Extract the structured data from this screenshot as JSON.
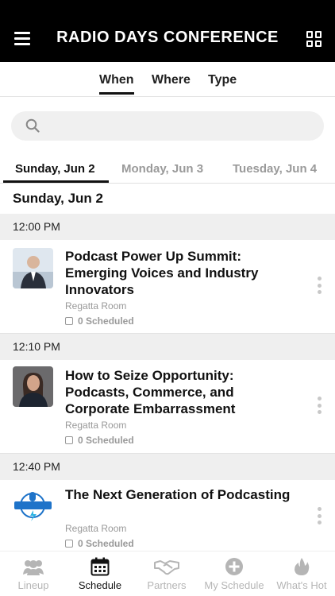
{
  "header": {
    "title": "RADIO DAYS CONFERENCE",
    "menu_icon": "hamburger-menu-icon",
    "view_icon": "grid-view-icon"
  },
  "filter_tabs": [
    {
      "label": "When",
      "active": true
    },
    {
      "label": "Where",
      "active": false
    },
    {
      "label": "Type",
      "active": false
    }
  ],
  "search": {
    "placeholder": "",
    "icon": "search-icon"
  },
  "day_tabs": [
    {
      "label": "Sunday, Jun 2",
      "active": true
    },
    {
      "label": "Monday, Jun 3",
      "active": false
    },
    {
      "label": "Tuesday, Jun 4",
      "active": false
    }
  ],
  "date_heading": "Sunday, Jun 2",
  "sessions": [
    {
      "time": "12:00 PM",
      "title": "Podcast Power Up Summit: Emerging Voices and Industry Innovators",
      "room": "Regatta Room",
      "scheduled": "0 Scheduled"
    },
    {
      "time": "12:10 PM",
      "title": "How to Seize Opportunity: Podcasts, Commerce, and Corporate Embarrassment",
      "room": "Regatta Room",
      "scheduled": "0 Scheduled"
    },
    {
      "time": "12:40 PM",
      "title": "The Next Generation of Podcasting",
      "room": "Regatta Room",
      "scheduled": "0 Scheduled"
    }
  ],
  "bottom_nav": [
    {
      "label": "Lineup",
      "icon": "people-icon",
      "active": false
    },
    {
      "label": "Schedule",
      "icon": "calendar-icon",
      "active": true
    },
    {
      "label": "Partners",
      "icon": "handshake-icon",
      "active": false
    },
    {
      "label": "My Schedule",
      "icon": "plus-circle-icon",
      "active": false
    },
    {
      "label": "What's Hot",
      "icon": "flame-icon",
      "active": false
    }
  ],
  "colors": {
    "header_bg": "#000000",
    "inactive": "#9a9a9a",
    "time_bar_bg": "#efefef"
  }
}
